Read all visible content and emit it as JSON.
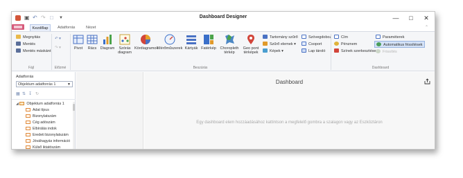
{
  "window": {
    "title": "Dashboard Designer"
  },
  "qat": {
    "icons": [
      "app-icon",
      "save-icon",
      "undo-icon",
      "redo-icon",
      "new-icon",
      "qat-menu-icon"
    ]
  },
  "tabs": {
    "home": "Kezdőlap",
    "datasource": "Adatforrás",
    "view": "Nézet"
  },
  "ribbon": {
    "file": {
      "open": "Megnyitás",
      "save": "Mentés",
      "save_as": "Mentés máskánt",
      "label": "Fájl"
    },
    "history": {
      "label": "Előzmé"
    },
    "insert": {
      "items": [
        "Pivot",
        "Rács",
        "Diagram",
        "Szórás diagram",
        "Kördiagramok",
        "Mérőműszerek",
        "Kártyák",
        "Fatérkép",
        "Choropleth térkép",
        "Geo pont térképek"
      ],
      "range_filter": "Tartomány szűrő",
      "filter_elements": "Szűrő elemek",
      "images": "Képek",
      "textbox": "Szövegdoboz",
      "group": "Csoport",
      "tab_container": "Lap tároló",
      "label": "Beszúrás"
    },
    "dashboard": {
      "title": "Cím",
      "currency": "Pénznem",
      "color_edit": "Színek szerkesztése",
      "parameters": "Paraméterek",
      "auto_update": "Automatikus frissítések",
      "refresh": "Frissítés",
      "label": "Dashboard"
    }
  },
  "datasource_panel": {
    "label": "Adatforrás",
    "selected": "Objektum adatforrás 1",
    "root": "Objektum adatforrás 1",
    "fields": [
      "Adat típus",
      "Bizonylatszám",
      "Cég adószám",
      "Elbírálás indok",
      "Eredeti bizonylatszám",
      "Jóváhagyás információ",
      "Külső iktatószám"
    ]
  },
  "canvas": {
    "title": "Dashboard",
    "hint": "Egy dashboard elem hozzáadásához kattintson a megfelelő gombra a szalagon vagy az Eszköztáron"
  }
}
